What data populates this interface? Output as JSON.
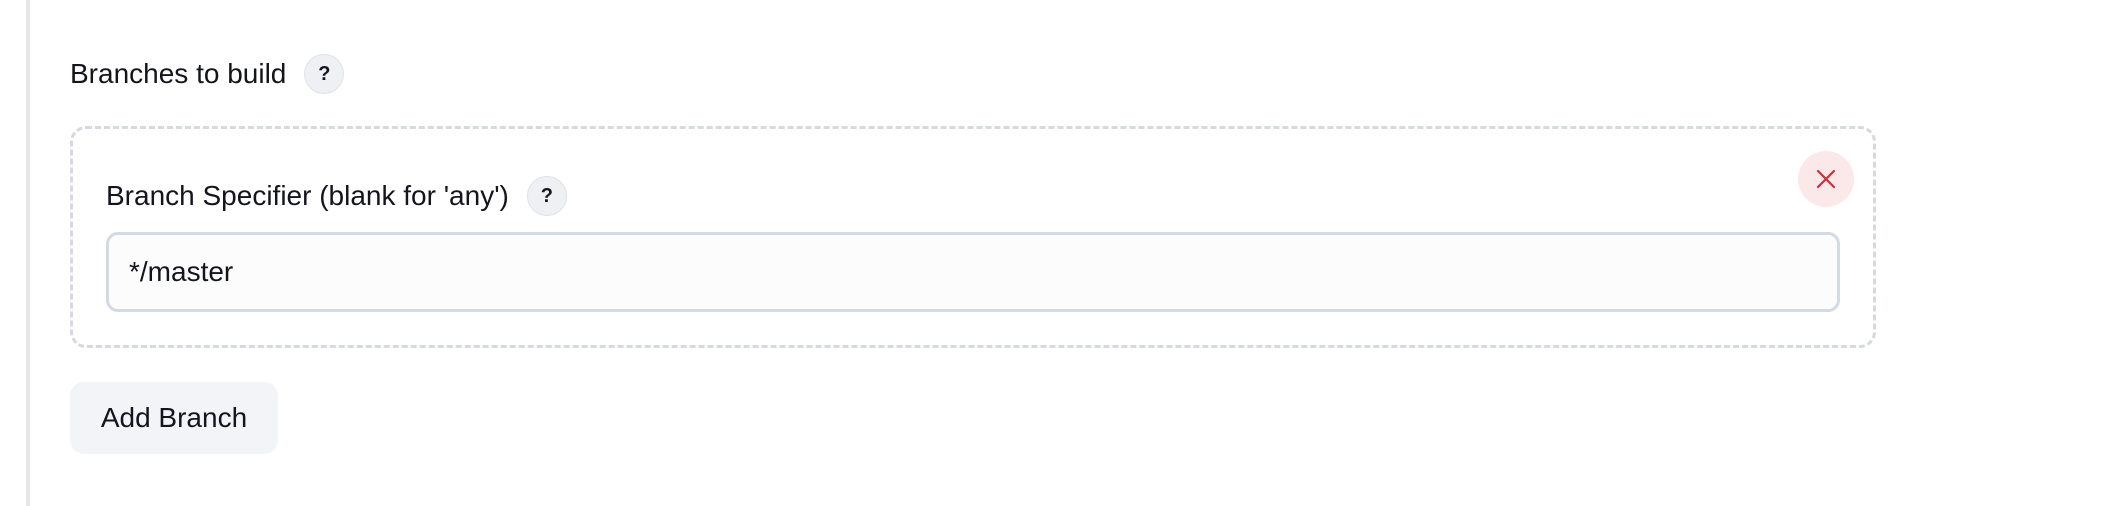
{
  "branches_section": {
    "title": "Branches to build",
    "help_label": "?"
  },
  "branch_entry": {
    "label": "Branch Specifier (blank for 'any')",
    "help_label": "?",
    "value": "*/master",
    "delete_icon": "close-icon"
  },
  "actions": {
    "add_branch_label": "Add Branch"
  },
  "colors": {
    "delete_accent": "#c7313a",
    "delete_bg": "#fbe9ea"
  }
}
